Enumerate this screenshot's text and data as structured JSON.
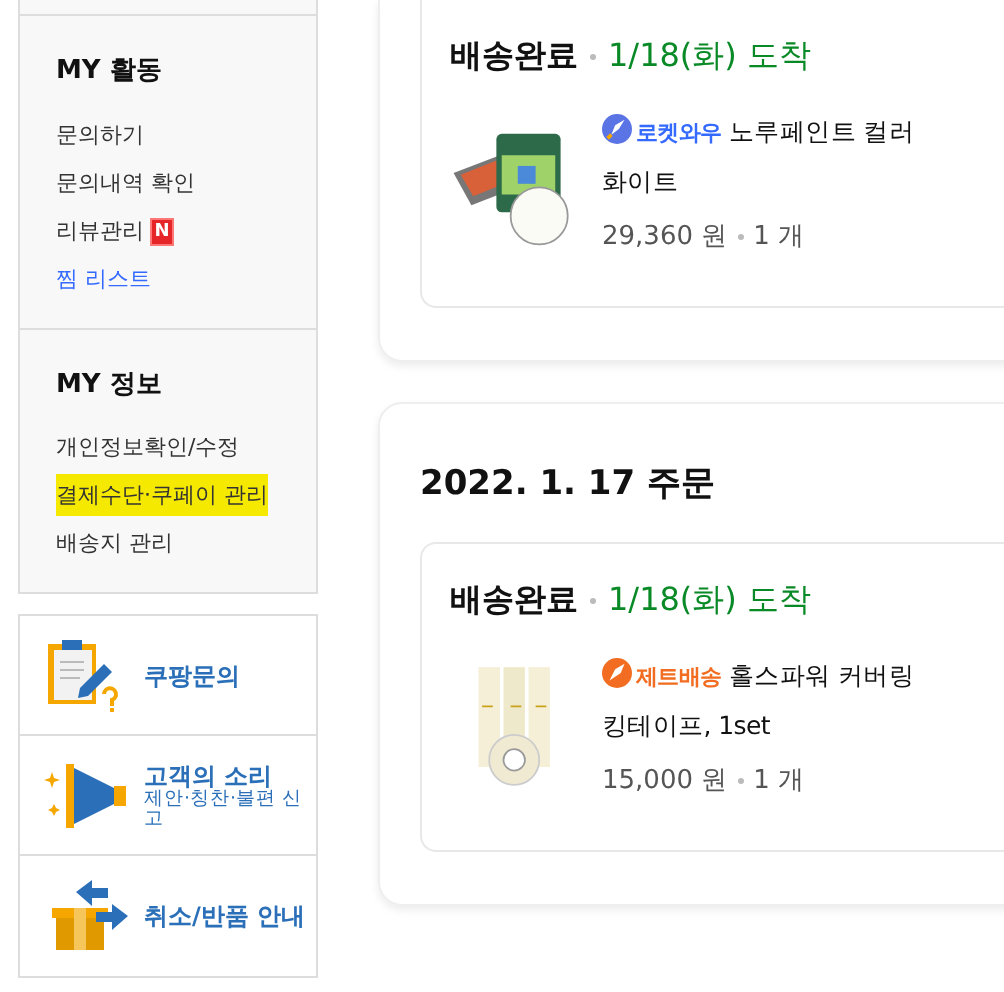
{
  "sidebar": {
    "sections": [
      {
        "title": "MY 활동",
        "items": [
          {
            "label": "문의하기",
            "kind": "plain"
          },
          {
            "label": "문의내역 확인",
            "kind": "plain"
          },
          {
            "label": "리뷰관리",
            "kind": "new",
            "badge": "N"
          },
          {
            "label": "찜 리스트",
            "kind": "link"
          }
        ]
      },
      {
        "title": "MY 정보",
        "items": [
          {
            "label": "개인정보확인/수정",
            "kind": "plain"
          },
          {
            "label": "결제수단·쿠페이 관리",
            "kind": "plain",
            "highlighted": true
          },
          {
            "label": "배송지 관리",
            "kind": "plain"
          }
        ]
      }
    ],
    "services": [
      {
        "kind": "inquiry",
        "title": "쿠팡문의"
      },
      {
        "kind": "voice",
        "title": "고객의 소리",
        "subtitle": "제안·칭찬·불편 신고"
      },
      {
        "kind": "return",
        "title": "취소/반품 안내"
      }
    ]
  },
  "orders": [
    {
      "shipments": [
        {
          "status": "배송완료",
          "arrival": "1/18(화) 도착",
          "items": [
            {
              "kind": "rocket",
              "service": "로켓와우",
              "name": [
                "노루페인트 컬러",
                "화이트"
              ],
              "price": "29,360 원",
              "qty": "1 개"
            }
          ]
        }
      ]
    },
    {
      "date": "2022. 1. 17 주문",
      "shipments": [
        {
          "status": "배송완료",
          "arrival": "1/18(화) 도착",
          "items": [
            {
              "kind": "jet",
              "service": "제트배송",
              "name": [
                "홀스파워 커버링",
                "킹테이프, 1set"
              ],
              "price": "15,000 원",
              "qty": "1 개"
            }
          ]
        }
      ]
    }
  ]
}
